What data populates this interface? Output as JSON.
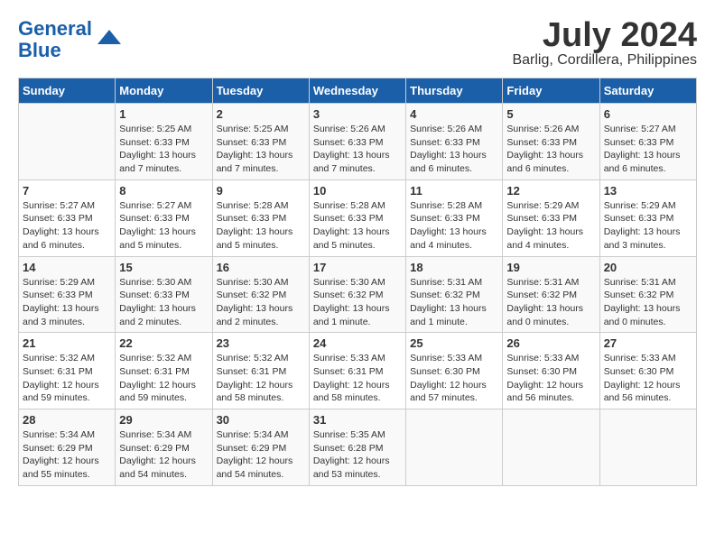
{
  "header": {
    "logo_line1": "General",
    "logo_line2": "Blue",
    "title": "July 2024",
    "subtitle": "Barlig, Cordillera, Philippines"
  },
  "weekdays": [
    "Sunday",
    "Monday",
    "Tuesday",
    "Wednesday",
    "Thursday",
    "Friday",
    "Saturday"
  ],
  "weeks": [
    [
      {
        "day": "",
        "detail": ""
      },
      {
        "day": "1",
        "detail": "Sunrise: 5:25 AM\nSunset: 6:33 PM\nDaylight: 13 hours\nand 7 minutes."
      },
      {
        "day": "2",
        "detail": "Sunrise: 5:25 AM\nSunset: 6:33 PM\nDaylight: 13 hours\nand 7 minutes."
      },
      {
        "day": "3",
        "detail": "Sunrise: 5:26 AM\nSunset: 6:33 PM\nDaylight: 13 hours\nand 7 minutes."
      },
      {
        "day": "4",
        "detail": "Sunrise: 5:26 AM\nSunset: 6:33 PM\nDaylight: 13 hours\nand 6 minutes."
      },
      {
        "day": "5",
        "detail": "Sunrise: 5:26 AM\nSunset: 6:33 PM\nDaylight: 13 hours\nand 6 minutes."
      },
      {
        "day": "6",
        "detail": "Sunrise: 5:27 AM\nSunset: 6:33 PM\nDaylight: 13 hours\nand 6 minutes."
      }
    ],
    [
      {
        "day": "7",
        "detail": "Sunrise: 5:27 AM\nSunset: 6:33 PM\nDaylight: 13 hours\nand 6 minutes."
      },
      {
        "day": "8",
        "detail": "Sunrise: 5:27 AM\nSunset: 6:33 PM\nDaylight: 13 hours\nand 5 minutes."
      },
      {
        "day": "9",
        "detail": "Sunrise: 5:28 AM\nSunset: 6:33 PM\nDaylight: 13 hours\nand 5 minutes."
      },
      {
        "day": "10",
        "detail": "Sunrise: 5:28 AM\nSunset: 6:33 PM\nDaylight: 13 hours\nand 5 minutes."
      },
      {
        "day": "11",
        "detail": "Sunrise: 5:28 AM\nSunset: 6:33 PM\nDaylight: 13 hours\nand 4 minutes."
      },
      {
        "day": "12",
        "detail": "Sunrise: 5:29 AM\nSunset: 6:33 PM\nDaylight: 13 hours\nand 4 minutes."
      },
      {
        "day": "13",
        "detail": "Sunrise: 5:29 AM\nSunset: 6:33 PM\nDaylight: 13 hours\nand 3 minutes."
      }
    ],
    [
      {
        "day": "14",
        "detail": "Sunrise: 5:29 AM\nSunset: 6:33 PM\nDaylight: 13 hours\nand 3 minutes."
      },
      {
        "day": "15",
        "detail": "Sunrise: 5:30 AM\nSunset: 6:33 PM\nDaylight: 13 hours\nand 2 minutes."
      },
      {
        "day": "16",
        "detail": "Sunrise: 5:30 AM\nSunset: 6:32 PM\nDaylight: 13 hours\nand 2 minutes."
      },
      {
        "day": "17",
        "detail": "Sunrise: 5:30 AM\nSunset: 6:32 PM\nDaylight: 13 hours\nand 1 minute."
      },
      {
        "day": "18",
        "detail": "Sunrise: 5:31 AM\nSunset: 6:32 PM\nDaylight: 13 hours\nand 1 minute."
      },
      {
        "day": "19",
        "detail": "Sunrise: 5:31 AM\nSunset: 6:32 PM\nDaylight: 13 hours\nand 0 minutes."
      },
      {
        "day": "20",
        "detail": "Sunrise: 5:31 AM\nSunset: 6:32 PM\nDaylight: 13 hours\nand 0 minutes."
      }
    ],
    [
      {
        "day": "21",
        "detail": "Sunrise: 5:32 AM\nSunset: 6:31 PM\nDaylight: 12 hours\nand 59 minutes."
      },
      {
        "day": "22",
        "detail": "Sunrise: 5:32 AM\nSunset: 6:31 PM\nDaylight: 12 hours\nand 59 minutes."
      },
      {
        "day": "23",
        "detail": "Sunrise: 5:32 AM\nSunset: 6:31 PM\nDaylight: 12 hours\nand 58 minutes."
      },
      {
        "day": "24",
        "detail": "Sunrise: 5:33 AM\nSunset: 6:31 PM\nDaylight: 12 hours\nand 58 minutes."
      },
      {
        "day": "25",
        "detail": "Sunrise: 5:33 AM\nSunset: 6:30 PM\nDaylight: 12 hours\nand 57 minutes."
      },
      {
        "day": "26",
        "detail": "Sunrise: 5:33 AM\nSunset: 6:30 PM\nDaylight: 12 hours\nand 56 minutes."
      },
      {
        "day": "27",
        "detail": "Sunrise: 5:33 AM\nSunset: 6:30 PM\nDaylight: 12 hours\nand 56 minutes."
      }
    ],
    [
      {
        "day": "28",
        "detail": "Sunrise: 5:34 AM\nSunset: 6:29 PM\nDaylight: 12 hours\nand 55 minutes."
      },
      {
        "day": "29",
        "detail": "Sunrise: 5:34 AM\nSunset: 6:29 PM\nDaylight: 12 hours\nand 54 minutes."
      },
      {
        "day": "30",
        "detail": "Sunrise: 5:34 AM\nSunset: 6:29 PM\nDaylight: 12 hours\nand 54 minutes."
      },
      {
        "day": "31",
        "detail": "Sunrise: 5:35 AM\nSunset: 6:28 PM\nDaylight: 12 hours\nand 53 minutes."
      },
      {
        "day": "",
        "detail": ""
      },
      {
        "day": "",
        "detail": ""
      },
      {
        "day": "",
        "detail": ""
      }
    ]
  ]
}
